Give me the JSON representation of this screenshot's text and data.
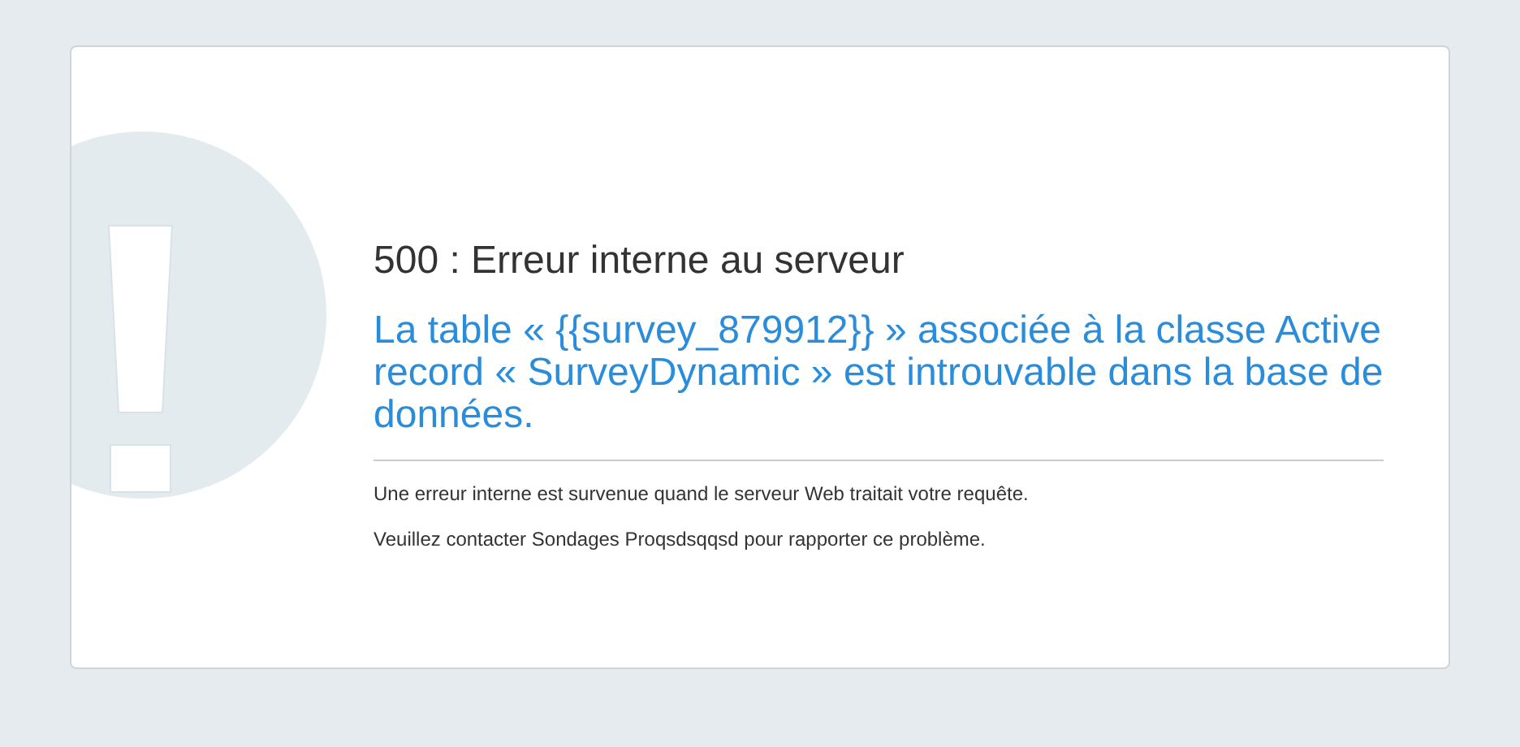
{
  "error": {
    "title": "500 : Erreur interne au serveur",
    "message": "La table « {{survey_879912}} » associée à la classe Active record « SurveyDynamic » est introuvable dans la base de données.",
    "details": [
      "Une erreur interne est survenue quand le serveur Web traitait votre requête.",
      "Veuillez contacter Sondages Proqsdsqqsd pour rapporter ce problème."
    ]
  }
}
